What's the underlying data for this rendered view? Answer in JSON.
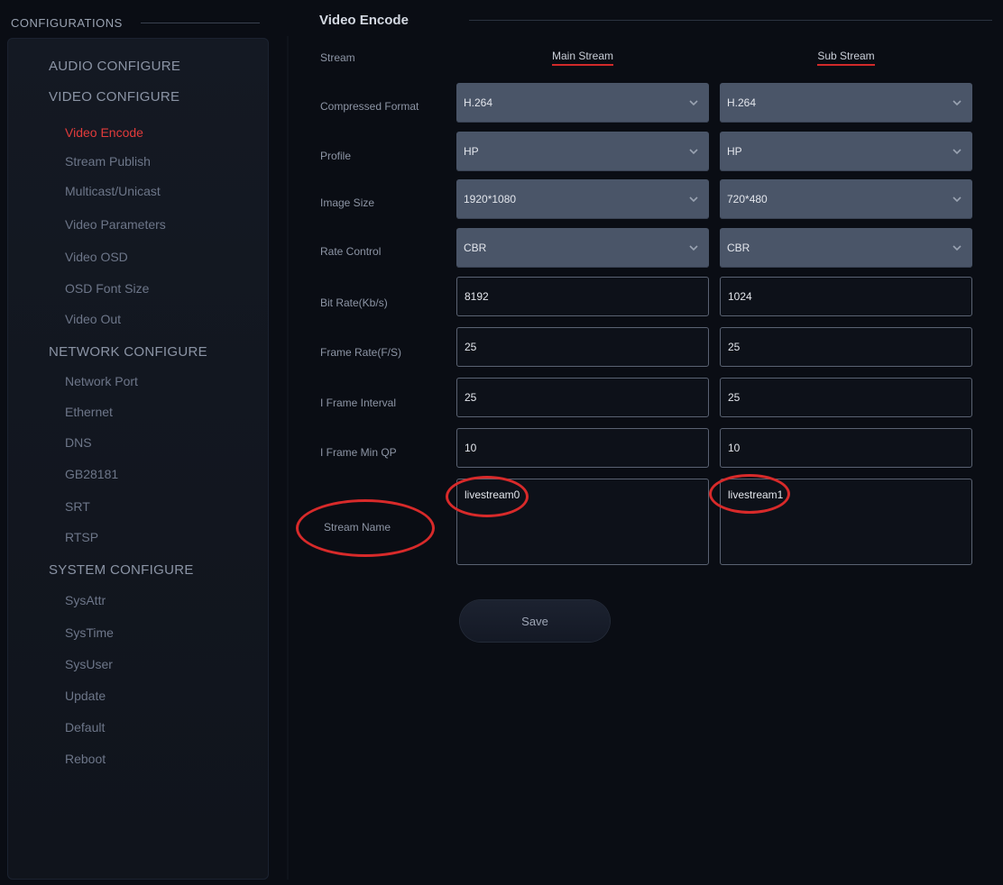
{
  "sidebar": {
    "header": "CONFIGURATIONS",
    "items": [
      {
        "label": "AUDIO CONFIGURE",
        "kind": "section"
      },
      {
        "label": "VIDEO CONFIGURE",
        "kind": "section"
      },
      {
        "label": "Video Encode",
        "kind": "sub",
        "active": true
      },
      {
        "label": "Stream Publish",
        "kind": "sub"
      },
      {
        "label": "Multicast/Unicast",
        "kind": "sub"
      },
      {
        "label": "Video Parameters",
        "kind": "sub"
      },
      {
        "label": "Video OSD",
        "kind": "sub"
      },
      {
        "label": "OSD Font Size",
        "kind": "sub"
      },
      {
        "label": "Video Out",
        "kind": "sub"
      },
      {
        "label": "NETWORK CONFIGURE",
        "kind": "section"
      },
      {
        "label": "Network Port",
        "kind": "sub"
      },
      {
        "label": "Ethernet",
        "kind": "sub"
      },
      {
        "label": "DNS",
        "kind": "sub"
      },
      {
        "label": "GB28181",
        "kind": "sub"
      },
      {
        "label": "SRT",
        "kind": "sub"
      },
      {
        "label": "RTSP",
        "kind": "sub"
      },
      {
        "label": "SYSTEM CONFIGURE",
        "kind": "section"
      },
      {
        "label": "SysAttr",
        "kind": "sub"
      },
      {
        "label": "SysTime",
        "kind": "sub"
      },
      {
        "label": "SysUser",
        "kind": "sub"
      },
      {
        "label": "Update",
        "kind": "sub"
      },
      {
        "label": "Default",
        "kind": "sub"
      },
      {
        "label": "Reboot",
        "kind": "sub"
      }
    ]
  },
  "main": {
    "title": "Video Encode",
    "stream_label": "Stream",
    "main_stream": "Main Stream",
    "sub_stream": "Sub Stream",
    "rows": {
      "compressed_format": {
        "label": "Compressed Format",
        "main": "H.264",
        "sub": "H.264"
      },
      "profile": {
        "label": "Profile",
        "main": "HP",
        "sub": "HP"
      },
      "image_size": {
        "label": "Image Size",
        "main": "1920*1080",
        "sub": "720*480"
      },
      "rate_control": {
        "label": "Rate Control",
        "main": "CBR",
        "sub": "CBR"
      },
      "bit_rate": {
        "label": "Bit Rate(Kb/s)",
        "main": "8192",
        "sub": "1024"
      },
      "frame_rate": {
        "label": "Frame Rate(F/S)",
        "main": "25",
        "sub": "25"
      },
      "iframe_interval": {
        "label": "I Frame Interval",
        "main": "25",
        "sub": "25"
      },
      "iframe_min_qp": {
        "label": "I Frame Min QP",
        "main": "10",
        "sub": "10"
      },
      "stream_name": {
        "label": "Stream Name",
        "main": "livestream0",
        "sub": "livestream1"
      }
    },
    "save_label": "Save"
  },
  "colors": {
    "accent": "#e23b3b",
    "select_bg": "#4a5568",
    "page_bg": "#0a0d14",
    "annotation": "#d82a2a"
  },
  "icons": {
    "select_arrow": "chevron-down-icon"
  }
}
